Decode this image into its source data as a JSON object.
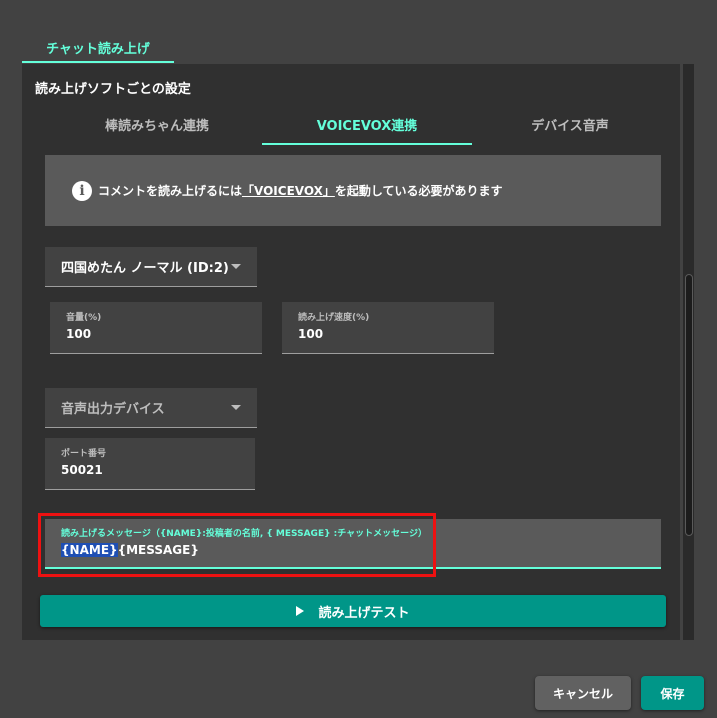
{
  "top_tab": {
    "label": "チャット読み上げ"
  },
  "section": {
    "title": "読み上げソフトごとの設定"
  },
  "subtabs": [
    {
      "label": "棒読みちゃん連携"
    },
    {
      "label": "VOICEVOX連携"
    },
    {
      "label": "デバイス音声"
    }
  ],
  "alert": {
    "icon": "info-icon",
    "prefix": "コメントを読み上げるには",
    "link": "「VOICEVOX」",
    "suffix": "を起動している必要があります"
  },
  "voice_select": {
    "value": "四国めたん ノーマル (ID:2)"
  },
  "volume": {
    "label": "音量(%)",
    "value": "100"
  },
  "speed": {
    "label": "読み上げ速度(%)",
    "value": "100"
  },
  "device_select": {
    "value": "音声出力デバイス"
  },
  "port": {
    "label": "ポート番号",
    "value": "50021"
  },
  "message": {
    "label": "読み上げるメッセージ（{NAME}:投稿者の名前, { MESSAGE} :チャットメッセージ）",
    "value_selected": "{NAME}",
    "value_rest": "{MESSAGE}"
  },
  "test_button": {
    "label": "読み上げテスト"
  },
  "footer": {
    "cancel": "キャンセル",
    "save": "保存"
  },
  "colors": {
    "accent": "#64ffda",
    "primary": "#009688",
    "highlight_box": "#ee1111"
  }
}
